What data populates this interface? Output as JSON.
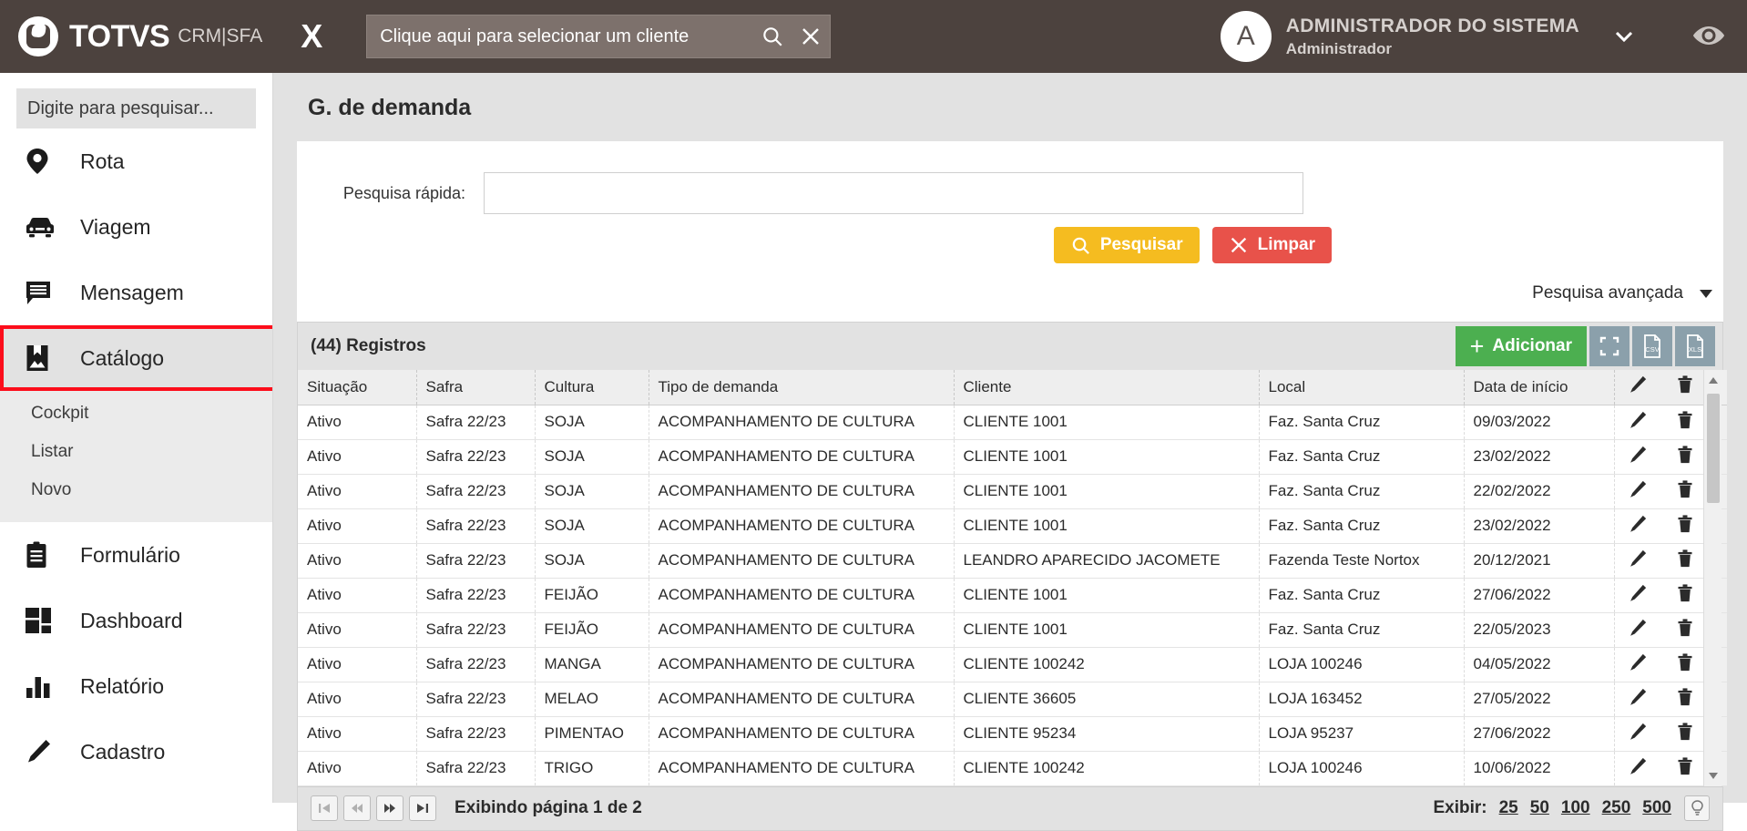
{
  "topbar": {
    "brand": "TOTVS",
    "brand_suffix": "CRM|SFA",
    "close_label": "X",
    "client_placeholder": "Clique aqui para selecionar um cliente",
    "user_initial": "A",
    "user_name": "ADMINISTRADOR DO SISTEMA",
    "user_role": "Administrador",
    "bg_color": "#4c423e"
  },
  "sidebar": {
    "search_placeholder": "Digite para pesquisar...",
    "items": [
      {
        "label": "Rota",
        "icon": "map-pin-icon",
        "active": false
      },
      {
        "label": "Viagem",
        "icon": "car-icon",
        "active": false
      },
      {
        "label": "Mensagem",
        "icon": "message-icon",
        "active": false
      },
      {
        "label": "Catálogo",
        "icon": "catalog-icon",
        "active": true
      },
      {
        "label": "Formulário",
        "icon": "clipboard-icon",
        "active": false
      },
      {
        "label": "Dashboard",
        "icon": "dashboard-icon",
        "active": false
      },
      {
        "label": "Relatório",
        "icon": "bar-chart-icon",
        "active": false
      },
      {
        "label": "Cadastro",
        "icon": "pencil-icon",
        "active": false
      }
    ],
    "submenu": [
      "Cockpit",
      "Listar",
      "Novo"
    ],
    "active_highlight_color": "#fc0d1b"
  },
  "main": {
    "page_title": "G. de demanda",
    "quick_search_label": "Pesquisa rápida:",
    "quick_search_value": "",
    "search_button": "Pesquisar",
    "clear_button": "Limpar",
    "advanced_search": "Pesquisa avançada",
    "search_button_color": "#f5bc20",
    "clear_button_color": "#e8524a"
  },
  "grid": {
    "record_count_label": "(44) Registros",
    "add_button": "Adicionar",
    "add_button_color": "#4caf50",
    "tools": [
      "fullscreen-icon",
      "csv-export-icon",
      "xls-export-icon"
    ],
    "columns": [
      "Situação",
      "Safra",
      "Cultura",
      "Tipo de demanda",
      "Cliente",
      "Local",
      "Data de início"
    ],
    "rows": [
      {
        "situacao": "Ativo",
        "safra": "Safra 22/23",
        "cultura": "SOJA",
        "tipo": "ACOMPANHAMENTO DE CULTURA",
        "cliente": "CLIENTE 1001",
        "local": "Faz. Santa Cruz",
        "data": "09/03/2022"
      },
      {
        "situacao": "Ativo",
        "safra": "Safra 22/23",
        "cultura": "SOJA",
        "tipo": "ACOMPANHAMENTO DE CULTURA",
        "cliente": "CLIENTE 1001",
        "local": "Faz. Santa Cruz",
        "data": "23/02/2022"
      },
      {
        "situacao": "Ativo",
        "safra": "Safra 22/23",
        "cultura": "SOJA",
        "tipo": "ACOMPANHAMENTO DE CULTURA",
        "cliente": "CLIENTE 1001",
        "local": "Faz. Santa Cruz",
        "data": "22/02/2022"
      },
      {
        "situacao": "Ativo",
        "safra": "Safra 22/23",
        "cultura": "SOJA",
        "tipo": "ACOMPANHAMENTO DE CULTURA",
        "cliente": "CLIENTE 1001",
        "local": "Faz. Santa Cruz",
        "data": "23/02/2022"
      },
      {
        "situacao": "Ativo",
        "safra": "Safra 22/23",
        "cultura": "SOJA",
        "tipo": "ACOMPANHAMENTO DE CULTURA",
        "cliente": "LEANDRO APARECIDO JACOMETE",
        "local": "Fazenda Teste Nortox",
        "data": "20/12/2021"
      },
      {
        "situacao": "Ativo",
        "safra": "Safra 22/23",
        "cultura": "FEIJÃO",
        "tipo": "ACOMPANHAMENTO DE CULTURA",
        "cliente": "CLIENTE 1001",
        "local": "Faz. Santa Cruz",
        "data": "27/06/2022"
      },
      {
        "situacao": "Ativo",
        "safra": "Safra 22/23",
        "cultura": "FEIJÃO",
        "tipo": "ACOMPANHAMENTO DE CULTURA",
        "cliente": "CLIENTE 1001",
        "local": "Faz. Santa Cruz",
        "data": "22/05/2023"
      },
      {
        "situacao": "Ativo",
        "safra": "Safra 22/23",
        "cultura": "MANGA",
        "tipo": "ACOMPANHAMENTO DE CULTURA",
        "cliente": "CLIENTE 100242",
        "local": "LOJA 100246",
        "data": "04/05/2022"
      },
      {
        "situacao": "Ativo",
        "safra": "Safra 22/23",
        "cultura": "MELAO",
        "tipo": "ACOMPANHAMENTO DE CULTURA",
        "cliente": "CLIENTE 36605",
        "local": "LOJA 163452",
        "data": "27/05/2022"
      },
      {
        "situacao": "Ativo",
        "safra": "Safra 22/23",
        "cultura": "PIMENTAO",
        "tipo": "ACOMPANHAMENTO DE CULTURA",
        "cliente": "CLIENTE 95234",
        "local": "LOJA 95237",
        "data": "27/06/2022"
      },
      {
        "situacao": "Ativo",
        "safra": "Safra 22/23",
        "cultura": "TRIGO",
        "tipo": "ACOMPANHAMENTO DE CULTURA",
        "cliente": "CLIENTE 100242",
        "local": "LOJA 100246",
        "data": "10/06/2022"
      }
    ],
    "footer": {
      "page_info": "Exibindo página 1 de 2",
      "exibir_label": "Exibir:",
      "page_sizes": [
        "25",
        "50",
        "100",
        "250",
        "500"
      ]
    }
  }
}
